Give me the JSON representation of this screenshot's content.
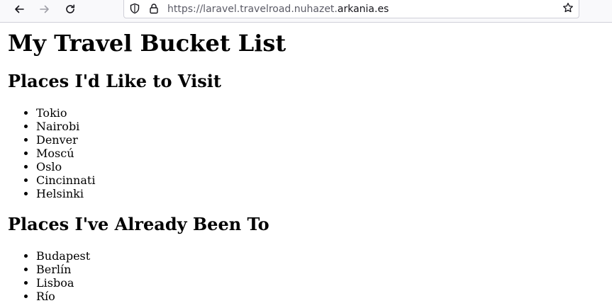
{
  "browser": {
    "url_prefix": "https://laravel.travelroad.nuhazet.",
    "url_domain": "arkania.es",
    "icons": {
      "back": "arrow-left-icon",
      "forward": "arrow-right-icon",
      "reload": "reload-icon",
      "shield": "shield-icon",
      "lock": "lock-icon",
      "bookmark": "star-icon"
    }
  },
  "page": {
    "title": "My Travel Bucket List",
    "sections": [
      {
        "heading": "Places I'd Like to Visit",
        "items": [
          "Tokio",
          "Nairobi",
          "Denver",
          "Moscú",
          "Oslo",
          "Cincinnati",
          "Helsinki"
        ]
      },
      {
        "heading": "Places I've Already Been To",
        "items": [
          "Budapest",
          "Berlín",
          "Lisboa",
          "Río"
        ]
      }
    ]
  }
}
